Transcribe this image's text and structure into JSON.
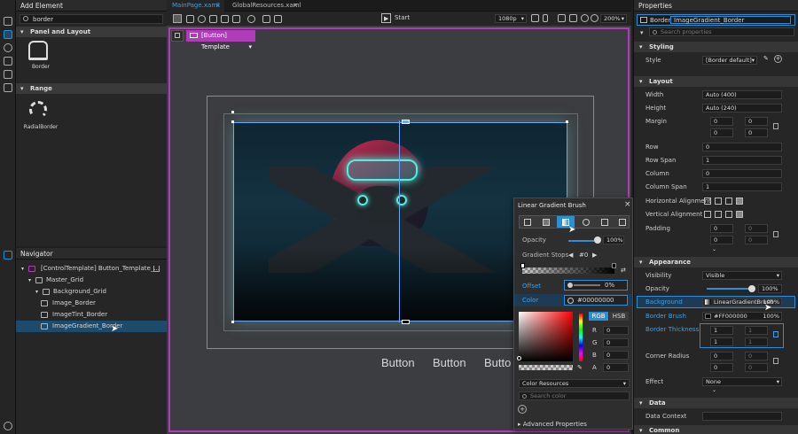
{
  "left_panel": {
    "title": "Add Element",
    "search": "border",
    "sections": [
      {
        "label": "Panel and Layout",
        "item": "Border"
      },
      {
        "label": "Range",
        "item": "RadialBorder"
      }
    ]
  },
  "navigator": {
    "title": "Navigator",
    "items": [
      "[ControlTemplate] Button_Template_...",
      "Master_Grid",
      "Background_Grid",
      "Image_Border",
      "ImageTint_Border",
      "ImageGradient_Border"
    ]
  },
  "tabs": [
    {
      "label": "MainPage.xaml"
    },
    {
      "label": "GlobalResources.xaml"
    }
  ],
  "toolbar": {
    "start": "Start",
    "resolution": "1080p",
    "zoom": "200%"
  },
  "canvas": {
    "breadcrumb": "[Button] Template",
    "buttons": [
      "Button",
      "Button",
      "Butto"
    ]
  },
  "popup": {
    "title": "Linear Gradient Brush",
    "opacity_label": "Opacity",
    "opacity_value": "100%",
    "stops_label": "Gradient Stops",
    "stop_index": "#0",
    "offset_label": "Offset",
    "offset_value": "0%",
    "color_label": "Color",
    "color_value": "#00000000",
    "rgb": "RGB",
    "hsb": "HSB",
    "channels": [
      {
        "l": "R",
        "v": "0"
      },
      {
        "l": "G",
        "v": "0"
      },
      {
        "l": "B",
        "v": "0"
      },
      {
        "l": "A",
        "v": "0"
      }
    ],
    "color_resources": "Color Resources",
    "search_placeholder": "Search color",
    "advanced": "Advanced Properties"
  },
  "props": {
    "title": "Properties",
    "type": "Border",
    "name": "ImageGradient_Border",
    "search_placeholder": "Search properties",
    "styling": "Styling",
    "style_label": "Style",
    "style_value": "[Border default]",
    "layout": "Layout",
    "width_label": "Width",
    "width": "Auto (400)",
    "height_label": "Height",
    "height": "Auto (240)",
    "margin_label": "Margin",
    "margin": [
      "0",
      "0",
      "0",
      "0"
    ],
    "row_label": "Row",
    "row": "0",
    "rowspan_label": "Row Span",
    "rowspan": "1",
    "col_label": "Column",
    "col": "0",
    "colspan_label": "Column Span",
    "colspan": "1",
    "halign_label": "Horizontal Alignment",
    "valign_label": "Vertical Alignment",
    "padding_label": "Padding",
    "padding": [
      "0",
      "0",
      "0",
      "0"
    ],
    "appearance": "Appearance",
    "vis_label": "Visibility",
    "vis": "Visible",
    "opacity_label": "Opacity",
    "opacity": "100%",
    "bg_label": "Background",
    "bg": "LinearGradientBrush",
    "bg_pct": "100%",
    "bb_label": "Border Brush",
    "bb": "#FF000000",
    "bb_pct": "100%",
    "bt_label": "Border Thickness",
    "bt": [
      "1",
      "1",
      "1",
      "1"
    ],
    "cr_label": "Corner Radius",
    "cr": [
      "0",
      "0",
      "0",
      "0"
    ],
    "effect_label": "Effect",
    "effect": "None",
    "data": "Data",
    "dc_label": "Data Context",
    "common": "Common"
  },
  "colors": {
    "accent": "#2b8fd6",
    "selection": "#b03cba"
  }
}
